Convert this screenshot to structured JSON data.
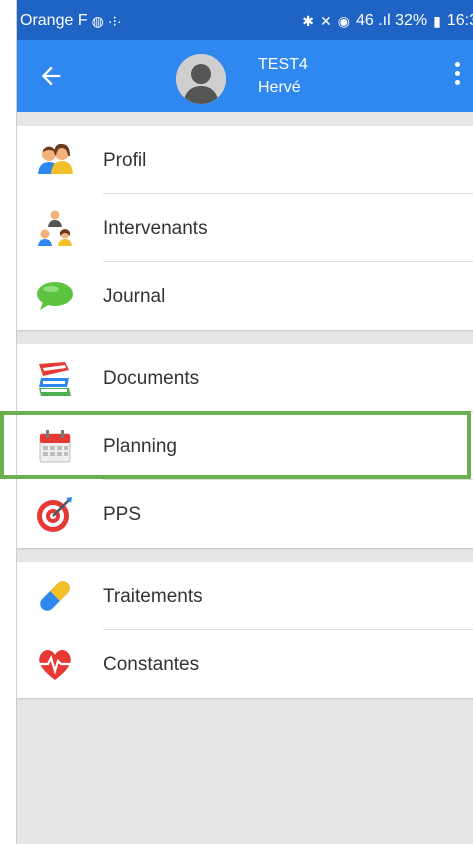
{
  "status_bar": {
    "carrier": "Orange F",
    "right_text": "46 .ıl 32%",
    "time": "16:3"
  },
  "header": {
    "title": "TEST4",
    "subtitle": "Hervé"
  },
  "menu": {
    "groups": [
      [
        {
          "label": "Profil",
          "icon": "profile-people-icon"
        },
        {
          "label": "Intervenants",
          "icon": "care-team-icon"
        },
        {
          "label": "Journal",
          "icon": "chat-bubble-icon"
        }
      ],
      [
        {
          "label": "Documents",
          "icon": "books-icon"
        },
        {
          "label": "Planning",
          "icon": "calendar-icon"
        },
        {
          "label": "PPS",
          "icon": "target-icon"
        }
      ],
      [
        {
          "label": "Traitements",
          "icon": "pill-capsule-icon"
        },
        {
          "label": "Constantes",
          "icon": "heart-pulse-icon"
        }
      ]
    ],
    "highlighted_item": "Planning"
  },
  "colors": {
    "status_bar": "#1f63c4",
    "app_bar": "#2f87f0",
    "highlight": "#6ab04c",
    "background": "#e6e6e6"
  }
}
